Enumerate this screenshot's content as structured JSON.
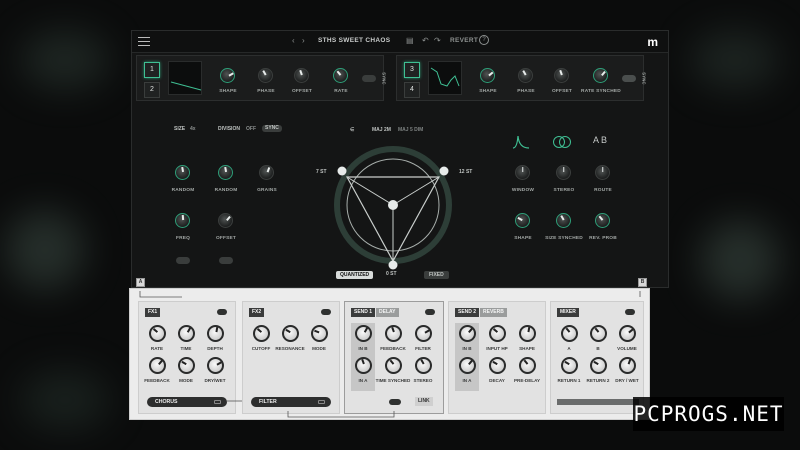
{
  "colors": {
    "accent": "#3fbf93",
    "background": "#0b0c0c",
    "fx_panel": "#ececec"
  },
  "topbar": {
    "preset_name": "STHS SWEET CHAOS",
    "revert_label": "REVERT",
    "help_label": "?"
  },
  "lfo_left": {
    "buttons": [
      "1",
      "2"
    ],
    "knobs": [
      "SHAPE",
      "PHASE",
      "OFFSET",
      "RATE"
    ],
    "sync_label": "SYNC"
  },
  "lfo_right": {
    "buttons": [
      "3",
      "4"
    ],
    "knobs": [
      "SHAPE",
      "PHASE",
      "OFFSET",
      "RATE SYNCHED"
    ],
    "sync_label": "SYNC"
  },
  "grain": {
    "size_label": "SIZE",
    "size_value": "4x",
    "division_label": "DIVISION",
    "division_value": "OFF",
    "sync_label": "SYNC",
    "knobs_row1": [
      "RANDOM",
      "RANDOM",
      "GRAINS"
    ],
    "knobs_row2": [
      "FREQ",
      "OFFSET"
    ]
  },
  "scale": {
    "key_main": "MAJ 2M",
    "key_alt": "MAJ 5 DIM",
    "left_label": "7 ST",
    "right_label": "12 ST",
    "bottom_label": "0 ST",
    "quantized_label": "QUANTIZED",
    "fixed_label": "FIXED"
  },
  "window": {
    "mode_letters": "A B",
    "knobs_row1": [
      "WINDOW",
      "STEREO",
      "ROUTE"
    ],
    "knobs_row2": [
      "SHAPE",
      "SIZE SYNCHED",
      "REV. PROB"
    ]
  },
  "markers": {
    "a": "A",
    "b": "B"
  },
  "fx": {
    "fx1": {
      "title": "FX1",
      "knobs": [
        "RATE",
        "TIME",
        "DEPTH",
        "FEEDBACK",
        "MODE",
        "DRY/WET"
      ],
      "select": "CHORUS"
    },
    "fx2": {
      "title": "FX2",
      "knobs": [
        "CUTOFF",
        "RESONANCE",
        "MODE"
      ],
      "select": "FILTER"
    },
    "send1": {
      "title": "SEND 1",
      "type": "DELAY",
      "knobs": [
        "IN B",
        "FEEDBACK",
        "FILTER",
        "IN A",
        "TIME SYNCHED",
        "STEREO"
      ],
      "link_label": "LINK"
    },
    "send2": {
      "title": "SEND 2",
      "type": "REVERB",
      "knobs": [
        "IN B",
        "INPUT HP",
        "SHAPE",
        "IN A",
        "DECAY",
        "PRE-DELAY"
      ]
    },
    "mixer": {
      "title": "MIXER",
      "knobs": [
        "A",
        "B",
        "VOLUME",
        "RETURN 1",
        "RETURN 2",
        "DRY / WET"
      ]
    }
  },
  "watermark": "PCPROGS.NET"
}
